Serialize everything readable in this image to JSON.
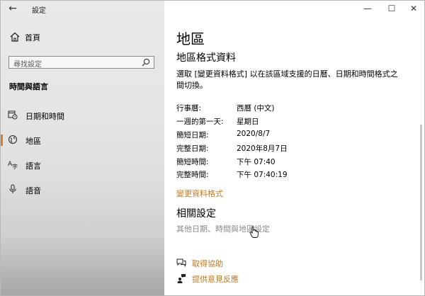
{
  "window": {
    "app_title": "設定",
    "controls": {
      "minimize": "—",
      "maximize": "☐",
      "close": "✕"
    }
  },
  "sidebar": {
    "home_label": "首頁",
    "search_placeholder": "尋找設定",
    "section_title": "時間與語言",
    "items": [
      {
        "label": "日期和時間",
        "icon": "calendar-clock-icon",
        "selected": false
      },
      {
        "label": "地區",
        "icon": "globe-icon",
        "selected": true
      },
      {
        "label": "語言",
        "icon": "language-icon",
        "selected": false
      },
      {
        "label": "語音",
        "icon": "microphone-icon",
        "selected": false
      }
    ],
    "accent_color": "#d0822b"
  },
  "main": {
    "title": "地區",
    "format_section_title": "地區格式資料",
    "description": "選取 [變更資料格式] 以在該區域支援的日曆、日期和時間格式之間切換。",
    "format_rows": [
      {
        "key": "行事曆:",
        "value": "西曆 (中文)"
      },
      {
        "key": "一週的第一天:",
        "value": "星期日"
      },
      {
        "key": "簡短日期:",
        "value": "2020/8/7"
      },
      {
        "key": "完整日期:",
        "value": "2020年8月7日"
      },
      {
        "key": "簡短時間:",
        "value": "下午 07:40"
      },
      {
        "key": "完整時間:",
        "value": "下午 07:40:19"
      }
    ],
    "change_format_link": "變更資料格式",
    "related_title": "相關設定",
    "related_link": "其他日期、時間與地區設定",
    "help_link": "取得協助",
    "feedback_link": "提供意見反應",
    "link_color": "#c57a1f"
  }
}
